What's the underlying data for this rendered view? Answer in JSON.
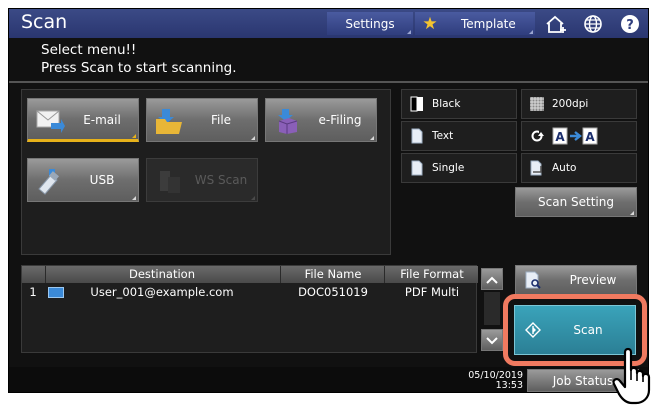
{
  "header": {
    "title": "Scan",
    "settings_label": "Settings",
    "template_label": "Template",
    "icons": [
      "star-icon",
      "home-plus-icon",
      "globe-icon",
      "help-icon"
    ]
  },
  "message": {
    "line1": "Select menu!!",
    "line2": "Press Scan to start scanning."
  },
  "destinations": [
    {
      "label": "E-mail",
      "icon": "email-icon",
      "selected": true,
      "enabled": true
    },
    {
      "label": "File",
      "icon": "folder-icon",
      "selected": false,
      "enabled": true
    },
    {
      "label": "e-Filing",
      "icon": "efiling-icon",
      "selected": false,
      "enabled": true
    },
    {
      "label": "USB",
      "icon": "usb-icon",
      "selected": false,
      "enabled": true
    },
    {
      "label": "WS Scan",
      "icon": "ws-scan-icon",
      "selected": false,
      "enabled": false
    }
  ],
  "scan_options": {
    "color_mode": "Black",
    "resolution": "200dpi",
    "original_mode": "Text",
    "sides": "Single",
    "rotation": "Auto",
    "scan_setting_label": "Scan Setting"
  },
  "jobs": {
    "columns": [
      "Destination",
      "File Name",
      "File Format"
    ],
    "rows": [
      {
        "index": "1",
        "destination": "User_001@example.com",
        "file_name": "DOC051019",
        "file_format": "PDF Multi"
      }
    ]
  },
  "actions": {
    "preview_label": "Preview",
    "scan_label": "Scan"
  },
  "status": {
    "date": "05/10/2019",
    "time": "13:53",
    "job_status_label": "Job Status"
  },
  "colors": {
    "title_bar": "#2f3d7d",
    "scan_button": "#2b8ea5",
    "highlight": "#f07a60",
    "selected_underline": "#e7b21a"
  }
}
